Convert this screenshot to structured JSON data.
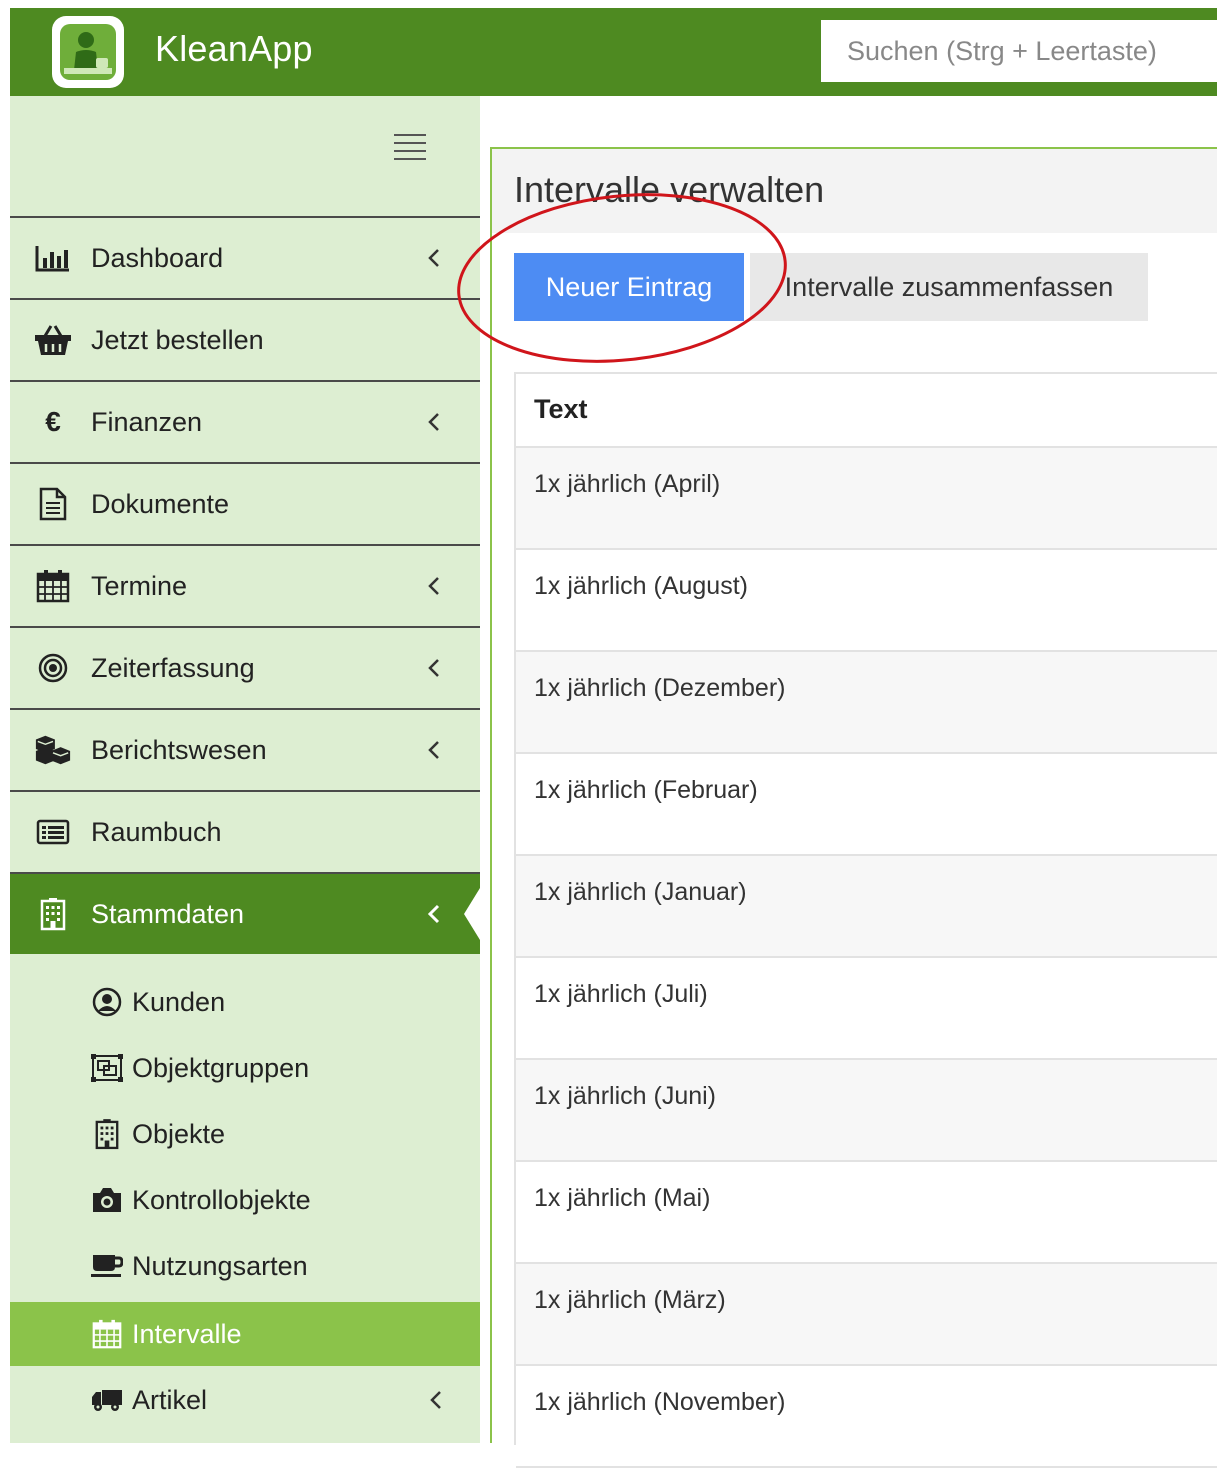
{
  "header": {
    "app_title": "KleanApp",
    "search_placeholder": "Suchen (Strg + Leertaste)"
  },
  "sidebar": {
    "items": [
      {
        "label": "Dashboard",
        "icon": "bar-chart-icon",
        "has_chevron": true
      },
      {
        "label": "Jetzt bestellen",
        "icon": "basket-icon",
        "has_chevron": false
      },
      {
        "label": "Finanzen",
        "icon": "euro-icon",
        "has_chevron": true
      },
      {
        "label": "Dokumente",
        "icon": "document-icon",
        "has_chevron": false
      },
      {
        "label": "Termine",
        "icon": "calendar-icon",
        "has_chevron": true
      },
      {
        "label": "Zeiterfassung",
        "icon": "target-icon",
        "has_chevron": true
      },
      {
        "label": "Berichtswesen",
        "icon": "cubes-icon",
        "has_chevron": true
      },
      {
        "label": "Raumbuch",
        "icon": "list-box-icon",
        "has_chevron": false
      },
      {
        "label": "Stammdaten",
        "icon": "building-icon",
        "has_chevron": true,
        "active": true
      }
    ],
    "sub_items": [
      {
        "label": "Kunden",
        "icon": "user-circle-icon"
      },
      {
        "label": "Objektgruppen",
        "icon": "object-group-icon"
      },
      {
        "label": "Objekte",
        "icon": "building-icon"
      },
      {
        "label": "Kontrollobjekte",
        "icon": "camera-icon"
      },
      {
        "label": "Nutzungsarten",
        "icon": "coffee-icon"
      },
      {
        "label": "Intervalle",
        "icon": "calendar-icon",
        "active": true
      },
      {
        "label": "Artikel",
        "icon": "truck-icon",
        "has_chevron": true
      }
    ]
  },
  "main": {
    "title": "Intervalle verwalten",
    "new_entry_label": "Neuer Eintrag",
    "merge_label": "Intervalle zusammenfassen",
    "table": {
      "header": "Text",
      "rows": [
        "1x jährlich (April)",
        "1x jährlich (August)",
        "1x jährlich (Dezember)",
        "1x jährlich (Februar)",
        "1x jährlich (Januar)",
        "1x jährlich (Juli)",
        "1x jährlich (Juni)",
        "1x jährlich (Mai)",
        "1x jährlich (März)",
        "1x jährlich (November)"
      ]
    }
  },
  "colors": {
    "brand_green": "#4e8a21",
    "sidebar_bg": "#ddeed2",
    "active_sub": "#8bc34a",
    "primary_button": "#4d8cf3",
    "annotation_red": "#d0151b"
  }
}
